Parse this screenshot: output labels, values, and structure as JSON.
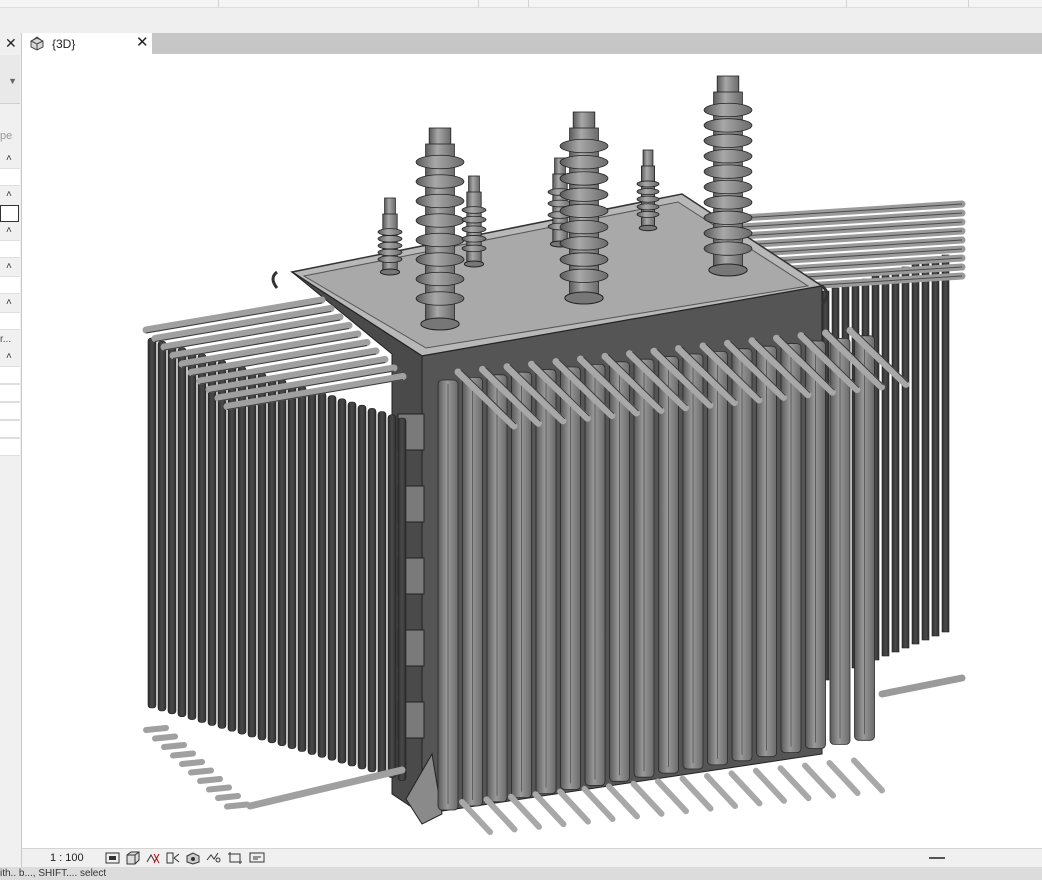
{
  "app": {
    "palette": {
      "panel_bg": "#f0f0f0",
      "tab_bg": "#c6c6c6",
      "viewport_bg": "#ffffff",
      "model_dark": "#3a3a3a",
      "model_mid": "#8a8a8a",
      "model_light": "#c8c8c8"
    }
  },
  "left_panel": {
    "close_glyph": "✕",
    "type_label_fragment": "pe",
    "collapse_glyph": "˄",
    "truncated_value": "r..."
  },
  "view_tab": {
    "icon": "3d-view-icon",
    "label": "{3D}",
    "close_glyph": "✕"
  },
  "status_bar": {
    "scale": "1 : 100",
    "controls": [
      "detail-level-icon",
      "visual-style-icon",
      "sun-path-icon",
      "shadows-icon",
      "render-icon",
      "crop-view-icon",
      "show-crop-region-icon",
      "temporary-hide-icon"
    ]
  },
  "hint": {
    "text": "ith.. b..., SHIFT.... select"
  }
}
